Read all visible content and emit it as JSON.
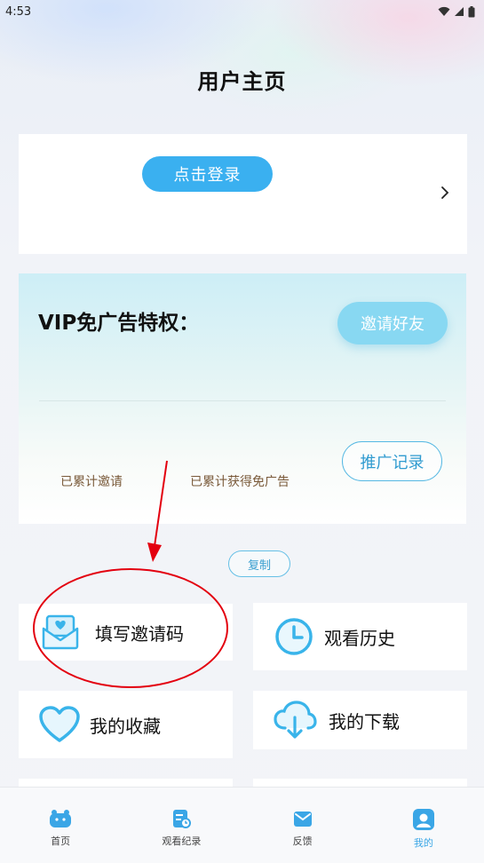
{
  "status_bar": {
    "time": "4:53"
  },
  "header": {
    "title": "用户主页"
  },
  "login_card": {
    "login_label": "点击登录"
  },
  "vip_card": {
    "title": "VIP免广告特权：",
    "invite_label": "邀请好友",
    "record_label": "推广记录",
    "stats": [
      {
        "label": "已累计邀请"
      },
      {
        "label": "已累计获得免广告"
      }
    ]
  },
  "copy_label": "复制",
  "menu": [
    {
      "label": "填写邀请码",
      "icon": "envelope-heart-icon"
    },
    {
      "label": "观看历史",
      "icon": "clock-icon"
    },
    {
      "label": "我的收藏",
      "icon": "heart-icon"
    },
    {
      "label": "我的下载",
      "icon": "cloud-download-icon"
    }
  ],
  "bottom_nav": [
    {
      "label": "首页",
      "icon": "home-icon",
      "active": false
    },
    {
      "label": "观看纪录",
      "icon": "history-doc-icon",
      "active": false
    },
    {
      "label": "反馈",
      "icon": "feedback-mail-icon",
      "active": false
    },
    {
      "label": "我的",
      "icon": "profile-icon",
      "active": true
    }
  ],
  "colors": {
    "accent": "#3ab0f0",
    "annotation": "#e3000f",
    "nav_active": "#3aa6e6"
  }
}
